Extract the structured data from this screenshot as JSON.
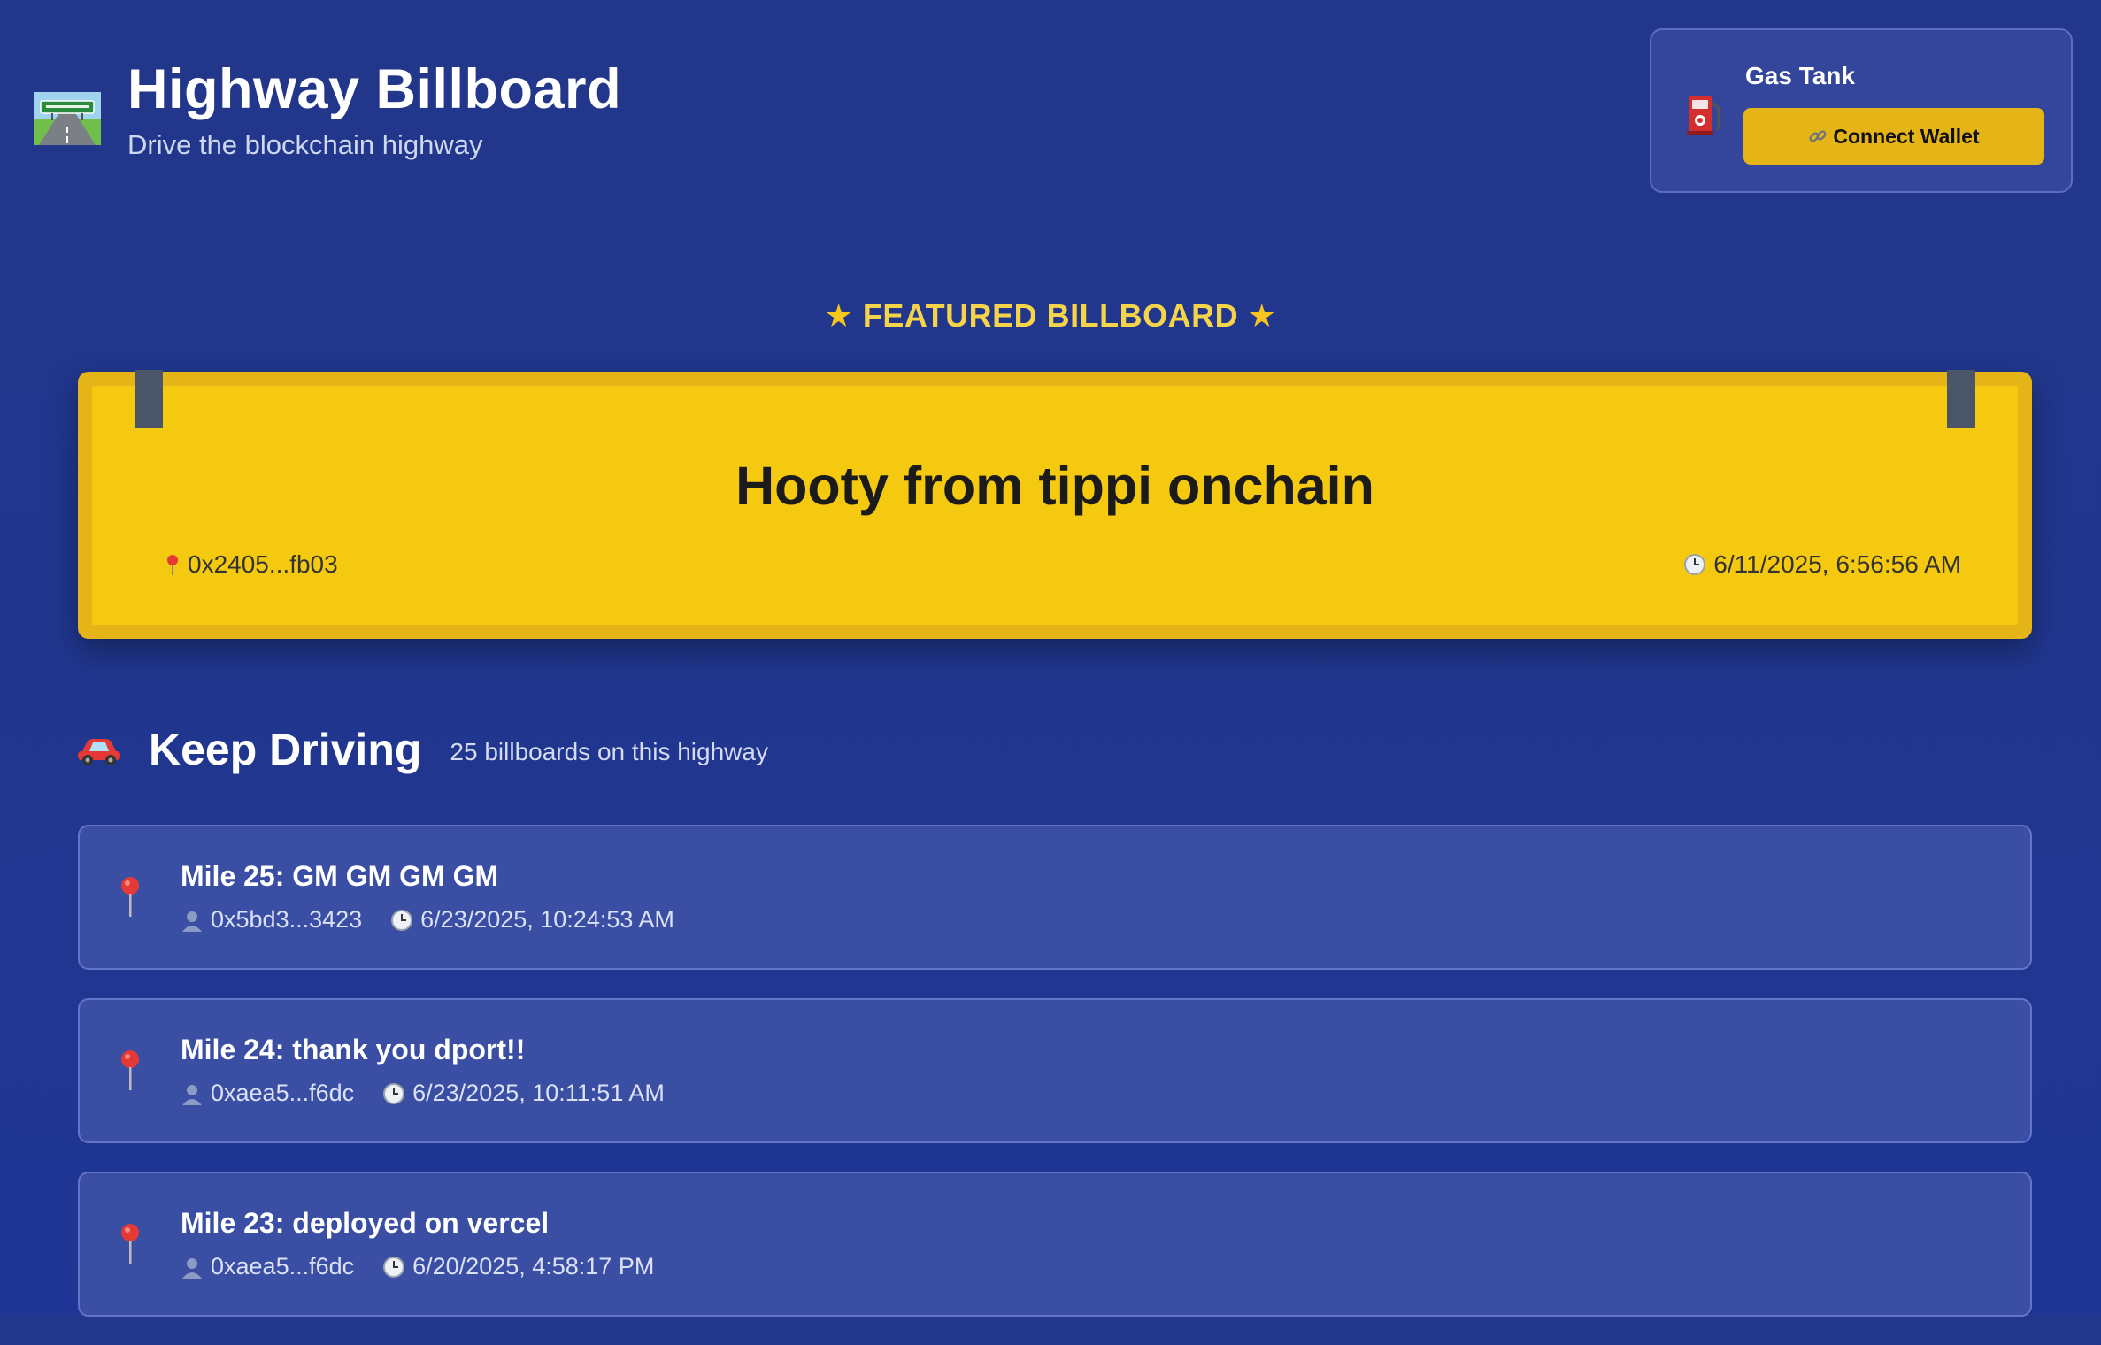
{
  "header": {
    "title": "Highway Billboard",
    "subtitle": "Drive the blockchain highway",
    "logo_icon": "highway-icon"
  },
  "gas_tank": {
    "title": "Gas Tank",
    "icon": "fuel-pump-icon",
    "connect_label": "Connect Wallet",
    "connect_icon": "link-icon"
  },
  "featured": {
    "label": "FEATURED BILLBOARD",
    "star_icon": "star-icon",
    "message": "Hooty from tippi onchain",
    "address": "0x2405...fb03",
    "timestamp": "6/11/2025, 6:56:56 AM"
  },
  "keep_driving": {
    "title": "Keep Driving",
    "count_text": "25 billboards on this highway",
    "items": [
      {
        "title": "Mile 25: GM GM GM GM",
        "address": "0x5bd3...3423",
        "timestamp": "6/23/2025, 10:24:53 AM"
      },
      {
        "title": "Mile 24: thank you dport!!",
        "address": "0xaea5...f6dc",
        "timestamp": "6/23/2025, 10:11:51 AM"
      },
      {
        "title": "Mile 23: deployed on vercel",
        "address": "0xaea5...f6dc",
        "timestamp": "6/20/2025, 4:58:17 PM"
      }
    ]
  },
  "colors": {
    "background": "#22378a",
    "accent_yellow": "#f5c90f",
    "billboard_frame": "#e5b417",
    "card_bg": "#3a4ea3",
    "featured_label": "#f6d44a"
  }
}
